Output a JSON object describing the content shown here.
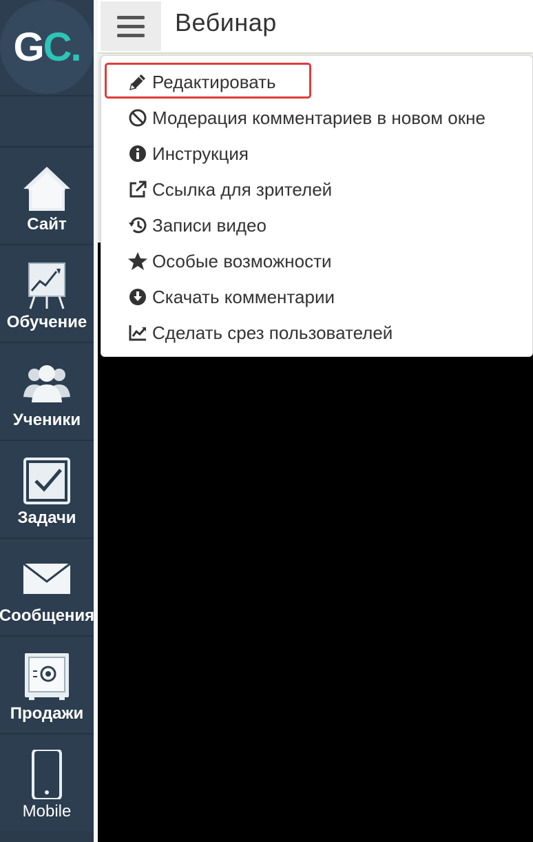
{
  "app": {
    "logo_text_g": "G",
    "logo_text_c": "C.",
    "brand_color": "#2ec4b6"
  },
  "header": {
    "title": "Вебинар",
    "menu_icon": "hamburger-icon"
  },
  "sidebar": {
    "items": [
      {
        "label": "Сайт",
        "icon": "house-icon"
      },
      {
        "label": "Обучение",
        "icon": "chart-board-icon"
      },
      {
        "label": "Ученики",
        "icon": "users-icon"
      },
      {
        "label": "Задачи",
        "icon": "checkbox-icon"
      },
      {
        "label": "Сообщения",
        "icon": "envelope-icon"
      },
      {
        "label": "Продажи",
        "icon": "safe-icon"
      },
      {
        "label": "Mobile",
        "icon": "phone-icon"
      }
    ]
  },
  "dropdown": {
    "items": [
      {
        "label": "Редактировать",
        "icon": "pencil-icon",
        "highlighted": true
      },
      {
        "label": "Модерация комментариев в новом окне",
        "icon": "ban-icon"
      },
      {
        "label": "Инструкция",
        "icon": "info-icon"
      },
      {
        "label": "Ссылка для зрителей",
        "icon": "external-link-icon"
      },
      {
        "label": "Записи видео",
        "icon": "history-icon"
      },
      {
        "label": "Особые возможности",
        "icon": "star-icon"
      },
      {
        "label": "Скачать комментарии",
        "icon": "download-icon"
      },
      {
        "label": "Сделать срез пользователей",
        "icon": "line-chart-icon"
      }
    ],
    "highlight_color": "#e03b3b"
  }
}
